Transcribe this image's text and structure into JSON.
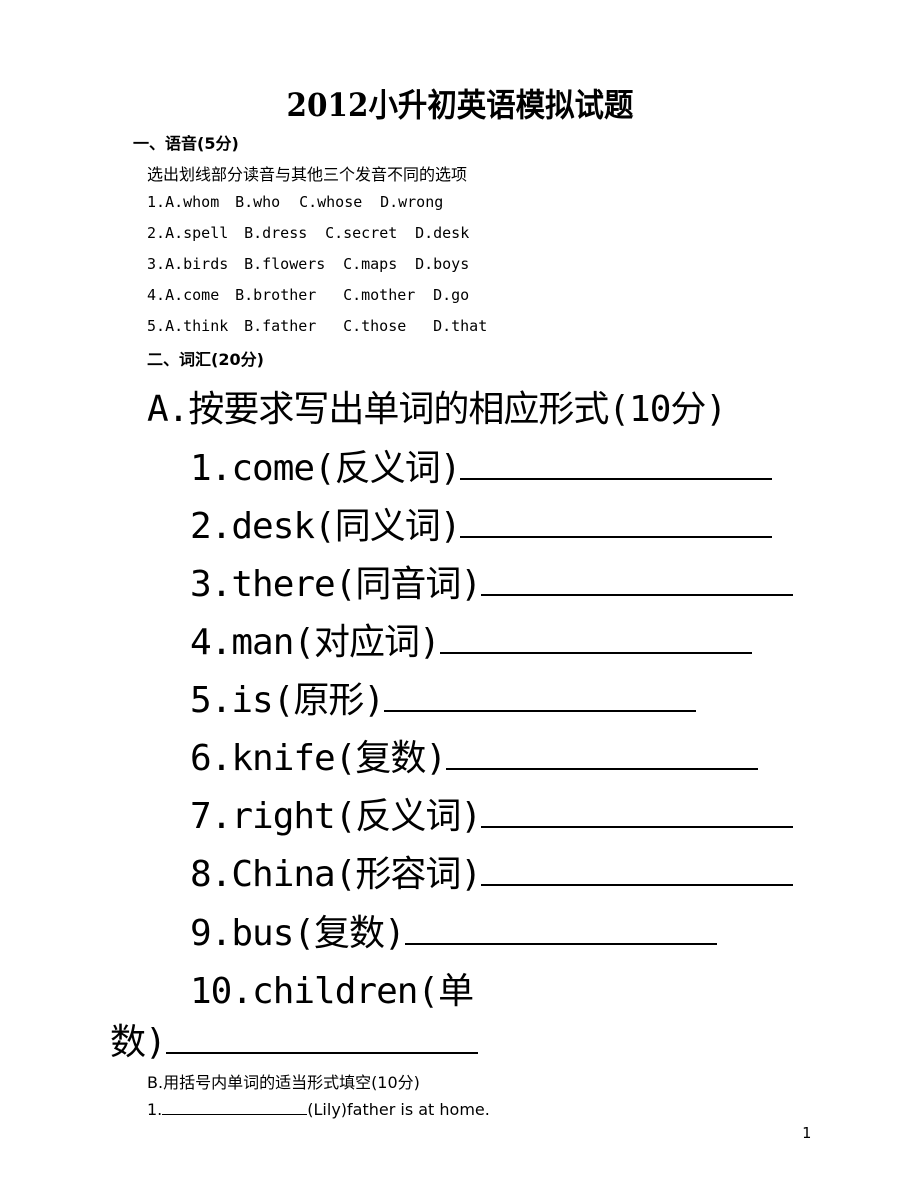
{
  "title": "2012小升初英语模拟试题",
  "section1": {
    "heading": "一、语音(5分)",
    "instruction": "选出划线部分读音与其他三个发音不同的选项",
    "questions": [
      {
        "num": "1.",
        "a": "A.whom",
        "b": "B.who",
        "c": "C.whose",
        "d": "D.wrong"
      },
      {
        "num": "2.",
        "a": "A.spell",
        "b": "B.dress",
        "c": "C.secret",
        "d": "D.desk"
      },
      {
        "num": "3.",
        "a": "A.birds",
        "b": "B.flowers",
        "c": "C.maps",
        "d": "D.boys"
      },
      {
        "num": "4.",
        "a": "A.come",
        "b": "B.brother",
        "c": "C.mother",
        "d": "D.go"
      },
      {
        "num": "5.",
        "a": "A.think",
        "b": "B.father",
        "c": "C.those",
        "d": "D.that"
      }
    ]
  },
  "section2": {
    "heading": "二、词汇(20分)",
    "partA": {
      "heading": "A.按要求写出单词的相应形式(10分)",
      "items": [
        "1.come(反义词)",
        "2.desk(同义词)",
        "3.there(同音词)",
        "4.man(对应词)",
        "5.is(原形)",
        "6.knife(复数)",
        "7.right(反义词)",
        "8.China(形容词)",
        "9.bus(复数)",
        "10.children(单"
      ],
      "item10_cont": "数)"
    },
    "partB": {
      "heading": "B.用括号内单词的适当形式填空(10分)",
      "q1_num": "1.",
      "q1_text": "(Lily)father is at home."
    }
  },
  "page_number": "1"
}
